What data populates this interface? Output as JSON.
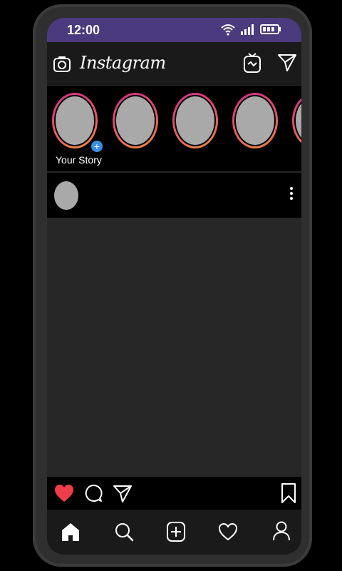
{
  "status_bar": {
    "time": "12:00",
    "icons": [
      "wifi-icon",
      "signal-icon",
      "battery-icon"
    ]
  },
  "header": {
    "logo_text": "Instagram",
    "left_icon": "camera-icon",
    "right_icons": [
      "igtv-icon",
      "direct-send-icon"
    ]
  },
  "stories": {
    "your_story_label": "Your Story",
    "items": [
      "your-story",
      "story-2",
      "story-3",
      "story-4",
      "story-5"
    ]
  },
  "post": {
    "header_icons": [
      "more-vertical-icon"
    ],
    "actions": [
      "like-heart-icon",
      "comment-icon",
      "share-icon",
      "bookmark-icon"
    ]
  },
  "tabbar": {
    "tabs": [
      "home-icon",
      "search-icon",
      "add-post-icon",
      "activity-heart-icon",
      "profile-icon"
    ]
  },
  "colors": {
    "status_bar": "#4b3a7e",
    "liked": "#ef3e4a",
    "story_ring_start": "#d12f8d",
    "story_ring_end": "#f08c3e",
    "add_badge": "#3b8fe3"
  }
}
